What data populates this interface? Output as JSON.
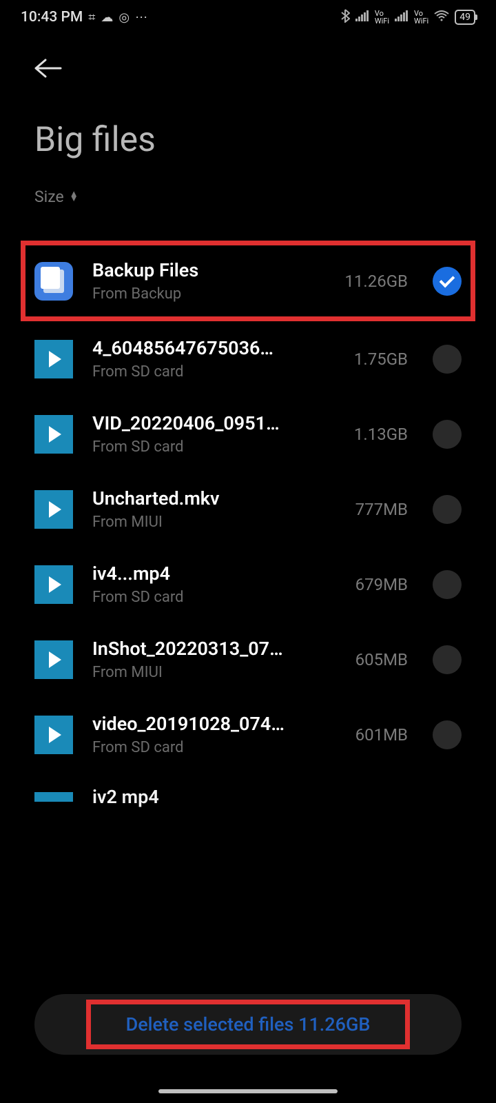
{
  "status_bar": {
    "time": "10:43 PM",
    "battery_level": "49"
  },
  "page_title": "Big files",
  "sort": {
    "label": "Size"
  },
  "files": [
    {
      "name": "Backup Files",
      "source": "From Backup",
      "size": "11.26GB",
      "icon_type": "backup",
      "selected": true,
      "highlighted": true
    },
    {
      "name": "4_60485647675036…",
      "source": "From SD card",
      "size": "1.75GB",
      "icon_type": "video",
      "selected": false
    },
    {
      "name": "VID_20220406_0951…",
      "source": "From SD card",
      "size": "1.13GB",
      "icon_type": "video",
      "selected": false
    },
    {
      "name": "Uncharted.mkv",
      "source": "From MIUI",
      "size": "777MB",
      "icon_type": "video",
      "selected": false
    },
    {
      "name": "iv4...mp4",
      "source": "From SD card",
      "size": "679MB",
      "icon_type": "video",
      "selected": false
    },
    {
      "name": "InShot_20220313_07…",
      "source": "From MIUI",
      "size": "605MB",
      "icon_type": "video",
      "selected": false
    },
    {
      "name": "video_20191028_074…",
      "source": "From SD card",
      "size": "601MB",
      "icon_type": "video",
      "selected": false
    }
  ],
  "partial_file": {
    "name": "iv2 mp4"
  },
  "delete_button": {
    "prefix": "Delete selected files ",
    "size": "11.26GB"
  }
}
